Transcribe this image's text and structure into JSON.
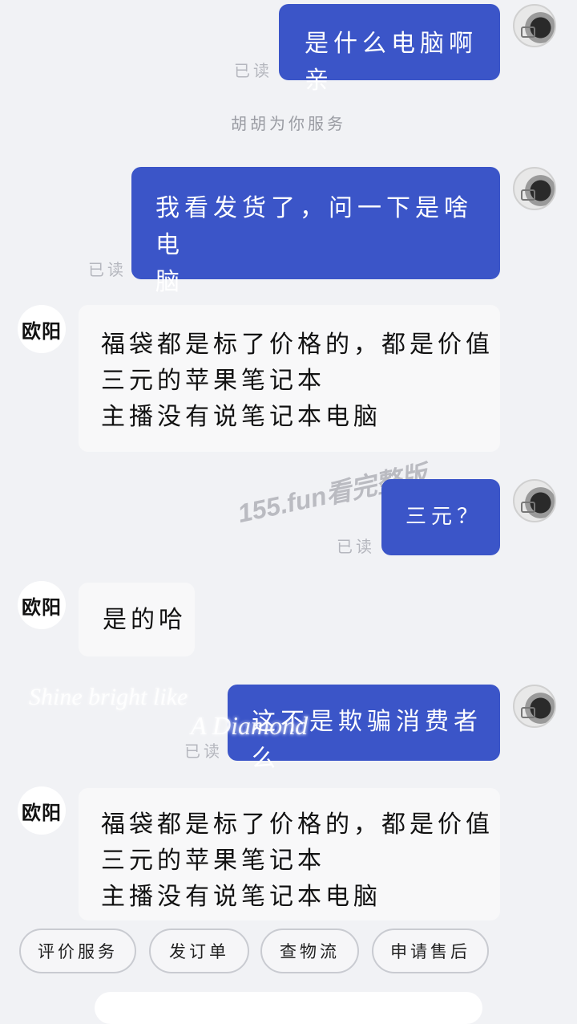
{
  "messages": [
    {
      "id": "m1",
      "from": "me",
      "text": "是什么电脑啊亲",
      "status": "已读"
    },
    {
      "id": "m2",
      "from": "me",
      "lines": [
        "我看发货了，问一下是啥电",
        "脑"
      ],
      "status": "已读"
    },
    {
      "id": "m3",
      "from": "shop",
      "sender": "欧阳",
      "lines": [
        "福袋都是标了价格的，都是价值",
        "三元的苹果笔记本",
        "主播没有说笔记本电脑"
      ]
    },
    {
      "id": "m4",
      "from": "me",
      "text": "三元？",
      "status": "已读"
    },
    {
      "id": "m5",
      "from": "shop",
      "sender": "欧阳",
      "text": "是的哈"
    },
    {
      "id": "m6",
      "from": "me",
      "text": "这不是欺骗消费者么",
      "status": "已读"
    },
    {
      "id": "m7",
      "from": "shop",
      "sender": "欧阳",
      "lines": [
        "福袋都是标了价格的，都是价值",
        "三元的苹果笔记本",
        "主播没有说笔记本电脑"
      ]
    }
  ],
  "system_notice": "胡胡为你服务",
  "watermark": "155.fun看完整版",
  "overlay_text": {
    "line1": "Shine bright like",
    "line2": "A Diamond"
  },
  "quick_actions": [
    "评价服务",
    "发订单",
    "查物流",
    "申请售后"
  ],
  "colors": {
    "outgoing_bubble": "#3b55c8",
    "incoming_bubble": "#f8f8f9",
    "background": "#f1f2f5"
  }
}
